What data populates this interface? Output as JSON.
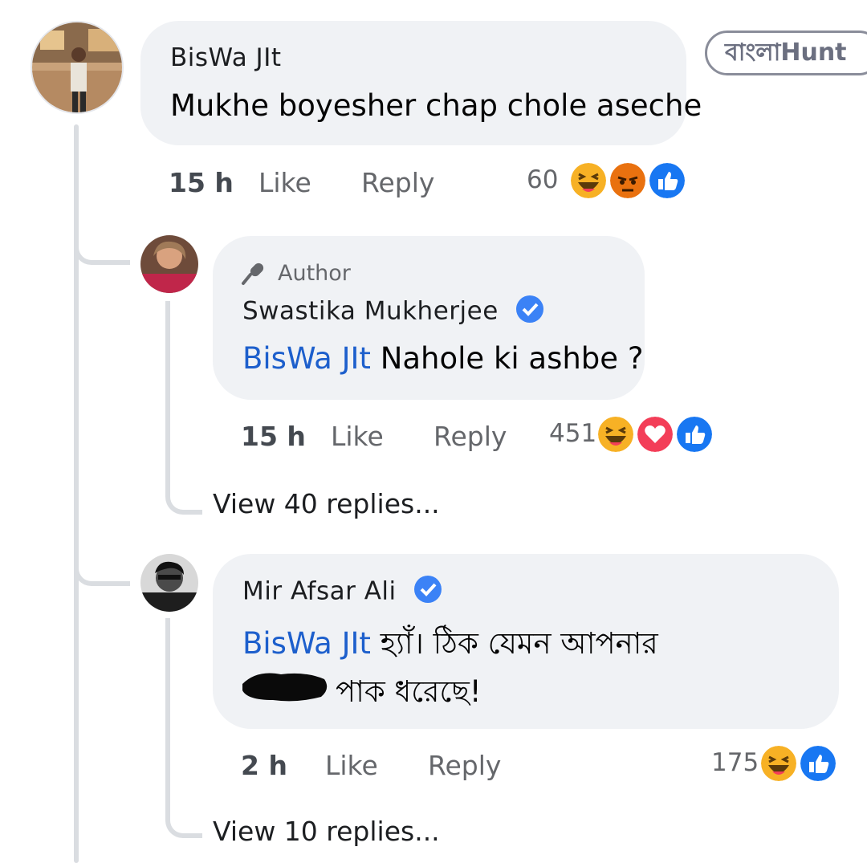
{
  "watermark": "বাংলাHunt",
  "comments": [
    {
      "author": "BisWa JIt",
      "text": "Mukhe boyesher chap chole aseche",
      "time": "15 h",
      "like": "Like",
      "reply": "Reply",
      "reaction_count": "60",
      "reactions": [
        "haha",
        "angry",
        "like"
      ]
    },
    {
      "badge": "Author",
      "author": "Swastika Mukherjee",
      "verified": true,
      "mention": "BisWa JIt",
      "text": " Nahole ki ashbe ?",
      "time": "15 h",
      "like": "Like",
      "reply": "Reply",
      "reaction_count": "451",
      "reactions": [
        "haha",
        "love",
        "like"
      ],
      "view_replies": "View 40 replies..."
    },
    {
      "author": "Mir Afsar Ali",
      "verified": true,
      "mention": "BisWa JIt",
      "text_line1": " হ্যাঁ। ঠিক যেমন আপনার",
      "text_line2_visible": "পাক ধরেছে!",
      "time": "2 h",
      "like": "Like",
      "reply": "Reply",
      "reaction_count": "175",
      "reactions": [
        "haha",
        "like"
      ],
      "view_replies": "View 10 replies..."
    }
  ],
  "colors": {
    "bubble": "#f0f2f5",
    "mention": "#1d5fcc",
    "verified": "#3b82f6",
    "like_blue": "#1877f2",
    "love_red": "#f33e58",
    "haha_yellow": "#f7b125",
    "angry_orange": "#e9710f"
  }
}
